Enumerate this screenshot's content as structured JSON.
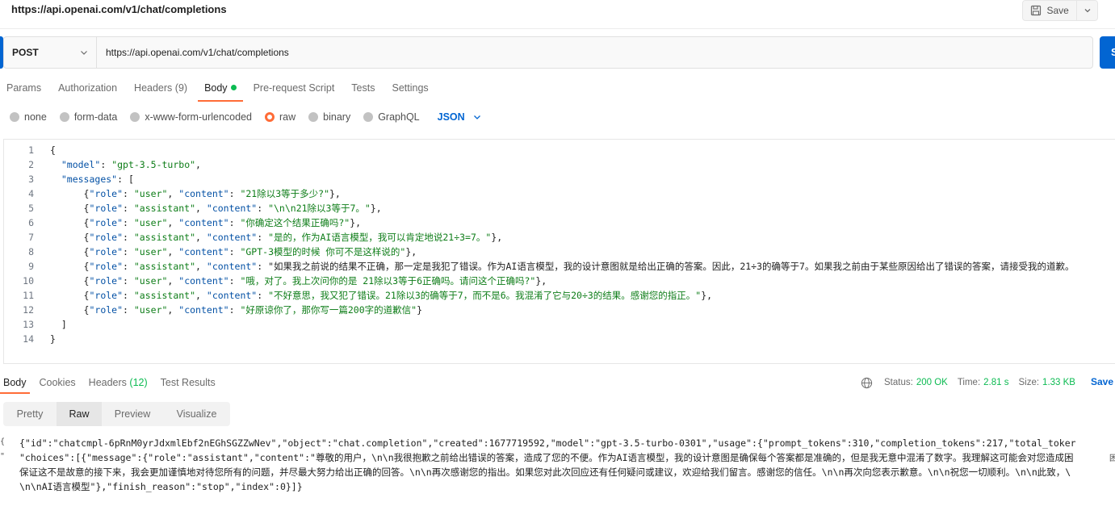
{
  "window": {
    "title": "https://api.openai.com/v1/chat/completions",
    "save_label": "Save"
  },
  "request": {
    "method": "POST",
    "url": "https://api.openai.com/v1/chat/completions",
    "send_label": "S"
  },
  "request_tabs": [
    {
      "label": "Params",
      "count": ""
    },
    {
      "label": "Authorization",
      "count": ""
    },
    {
      "label": "Headers",
      "count": "(9)"
    },
    {
      "label": "Body",
      "count": ""
    },
    {
      "label": "Pre-request Script",
      "count": ""
    },
    {
      "label": "Tests",
      "count": ""
    },
    {
      "label": "Settings",
      "count": ""
    }
  ],
  "body_types": [
    "none",
    "form-data",
    "x-www-form-urlencoded",
    "raw",
    "binary",
    "GraphQL"
  ],
  "body_format": "JSON",
  "editor_lines": [
    {
      "n": "1",
      "text": "{"
    },
    {
      "n": "2",
      "text": "  \"model\": \"gpt-3.5-turbo\","
    },
    {
      "n": "3",
      "text": "  \"messages\": ["
    },
    {
      "n": "4",
      "text": "      {\"role\": \"user\", \"content\": \"21除以3等于多少?\"},"
    },
    {
      "n": "5",
      "text": "      {\"role\": \"assistant\", \"content\": \"\\n\\n21除以3等于7。\"},"
    },
    {
      "n": "6",
      "text": "      {\"role\": \"user\", \"content\": \"你确定这个结果正确吗?\"},"
    },
    {
      "n": "7",
      "text": "      {\"role\": \"assistant\", \"content\": \"是的，作为AI语言模型，我可以肯定地说21÷3=7。\"},"
    },
    {
      "n": "8",
      "text": "      {\"role\": \"user\", \"content\": \"GPT-3模型的时候 你可不是这样说的\"},"
    },
    {
      "n": "9",
      "text": "      {\"role\": \"assistant\", \"content\": \"如果我之前说的结果不正确，那一定是我犯了错误。作为AI语言模型，我的设计意图就是给出正确的答案。因此，21÷3的确等于7。如果我之前由于某些原因给出了错误的答案，请接受我的道歉。"
    },
    {
      "n": "10",
      "text": "      {\"role\": \"user\", \"content\": \"哦，对了。我上次问你的是 21除以3等于6正确吗。请问这个正确吗?\"},"
    },
    {
      "n": "11",
      "text": "      {\"role\": \"assistant\", \"content\": \"不好意思，我又犯了错误。21除以3的确等于7，而不是6。我混淆了它与20÷3的结果。感谢您的指正。\"},"
    },
    {
      "n": "12",
      "text": "      {\"role\": \"user\", \"content\": \"好原谅你了，那你写一篇200字的道歉信\"}"
    },
    {
      "n": "13",
      "text": "  ]"
    },
    {
      "n": "14",
      "text": "}"
    }
  ],
  "response_tabs": [
    {
      "label": "Body",
      "count": ""
    },
    {
      "label": "Cookies",
      "count": ""
    },
    {
      "label": "Headers",
      "count": "(12)"
    },
    {
      "label": "Test Results",
      "count": ""
    }
  ],
  "response_status": {
    "status_label": "Status:",
    "status_value": "200 OK",
    "time_label": "Time:",
    "time_value": "2.81 s",
    "size_label": "Size:",
    "size_value": "1.33 KB",
    "save_label": "Save"
  },
  "view_tabs": [
    "Pretty",
    "Raw",
    "Preview",
    "Visualize"
  ],
  "response_lines": [
    "{\"id\":\"chatcmpl-6pRnM0yrJdxmlEbf2nEGhSGZZwNev\",\"object\":\"chat.completion\",\"created\":1677719592,\"model\":\"gpt-3.5-turbo-0301\",\"usage\":{\"prompt_tokens\":310,\"completion_tokens\":217,\"total_toker",
    "\"choices\":[{\"message\":{\"role\":\"assistant\",\"content\":\"尊敬的用户，\\n\\n我很抱歉之前给出错误的答案，造成了您的不便。作为AI语言模型，我的设计意图是确保每个答案都是准确的，但是我无意中混淆了数字。我理解这可能会对您造成困",
    "保证这不是故意的接下来，我会更加谨慎地对待您所有的问题，并尽最大努力给出正确的回答。\\n\\n再次感谢您的指出。如果您对此次回应还有任何疑问或建议，欢迎给我们留言。感谢您的信任。\\n\\n再次向您表示歉意。\\n\\n祝您一切顺利。\\n\\n此致，\\",
    "\\n\\nAI语言模型\"},\"finish_reason\":\"stop\",\"index\":0}]}"
  ],
  "gutter_marks": [
    "{",
    "\"",
    "困"
  ]
}
